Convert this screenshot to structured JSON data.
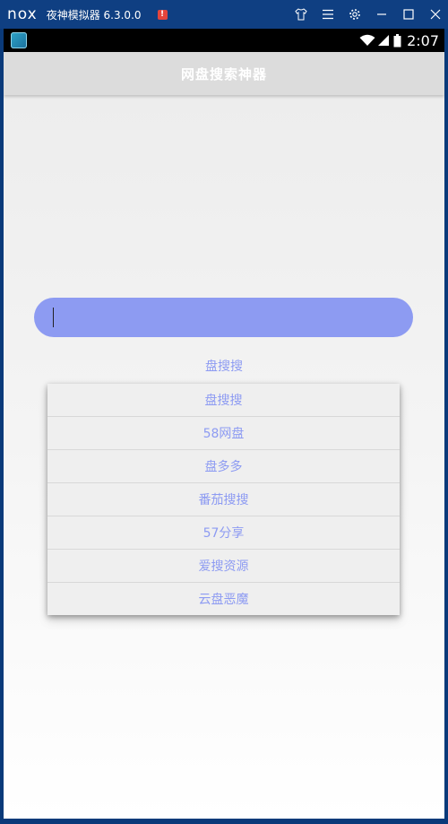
{
  "titlebar": {
    "logo": "nox",
    "title": "夜神模拟器 6.3.0.0",
    "alert_badge": "!",
    "icons": [
      "shirt-icon",
      "menu-icon",
      "gear-icon",
      "minimize-icon",
      "maximize-icon",
      "close-icon"
    ]
  },
  "statusbar": {
    "time": "2:07",
    "icons": [
      "app-icon",
      "wifi-icon",
      "signal-icon",
      "battery-icon"
    ]
  },
  "appbar": {
    "title": "网盘搜索神器"
  },
  "search": {
    "value": "",
    "placeholder": ""
  },
  "spinner": {
    "selected": "盘搜搜",
    "options": [
      "盘搜搜",
      "58网盘",
      "盘多多",
      "番茄搜搜",
      "57分享",
      "爱搜资源",
      "云盘恶魔"
    ]
  },
  "colors": {
    "accent": "#8d9bf2",
    "titlebar": "#0f3f82",
    "appbar": "#dcdcdc"
  }
}
